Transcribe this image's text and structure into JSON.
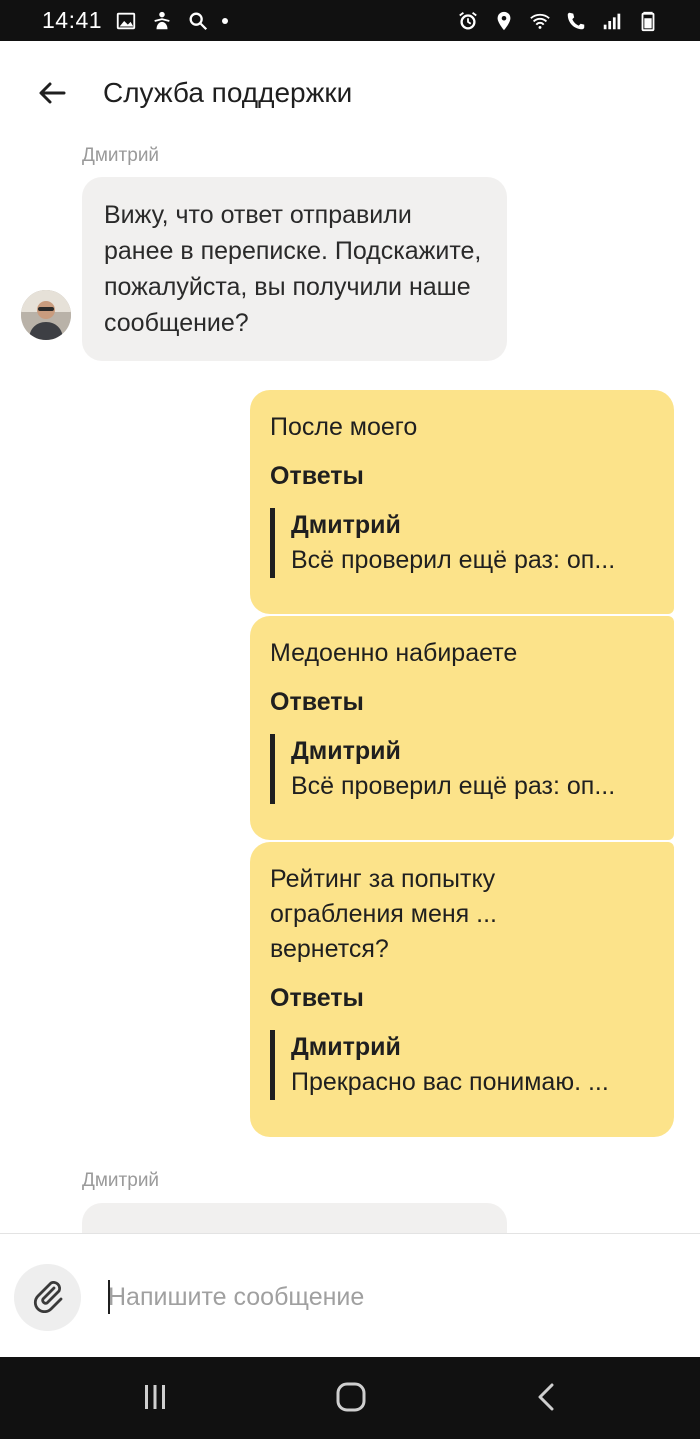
{
  "status_bar": {
    "time": "14:41",
    "left_icons": [
      "gallery-icon",
      "accessibility-icon",
      "search-icon",
      "notification-dot"
    ],
    "right_icons": [
      "alarm-icon",
      "location-icon",
      "wifi-icon",
      "wifi-call-icon",
      "signal-icon",
      "battery-icon"
    ]
  },
  "header": {
    "title": "Служба поддержки",
    "back_icon": "arrow-left-icon"
  },
  "messages": [
    {
      "type": "incoming",
      "sender": "Дмитрий",
      "text": "Вижу, что ответ отправили ранее в переписке. Подскажите, пожалуйста, вы получили наше сообщение?"
    },
    {
      "type": "outgoing",
      "text": "После моего",
      "replies_label": "Ответы",
      "quote_author": "Дмитрий",
      "quote_text": "Всё проверил ещё раз: оп..."
    },
    {
      "type": "outgoing",
      "text": "Медоенно набираете",
      "replies_label": "Ответы",
      "quote_author": "Дмитрий",
      "quote_text": "Всё проверил ещё раз: оп..."
    },
    {
      "type": "outgoing",
      "text": "Рейтинг за попытку ограбления меня ... вернется?",
      "replies_label": "Ответы",
      "quote_author": "Дмитрий",
      "quote_text": "Прекрасно вас понимаю. ..."
    },
    {
      "type": "incoming",
      "sender": "Дмитрий",
      "text": ""
    }
  ],
  "composer": {
    "placeholder": "Напишите сообщение",
    "attach_icon": "paperclip-icon"
  },
  "nav_bar": {
    "icons": [
      "recent-apps-icon",
      "home-icon",
      "back-icon"
    ]
  },
  "colors": {
    "outgoing_bubble": "#fce38a",
    "incoming_bubble": "#f1f0ef",
    "status_bar": "#111111"
  }
}
